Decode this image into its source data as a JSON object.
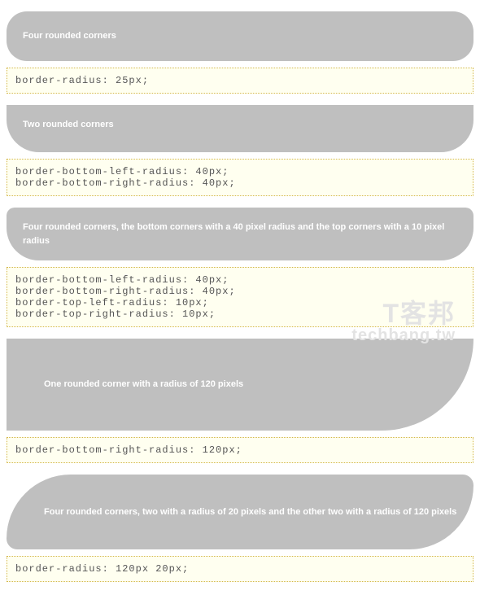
{
  "watermark": {
    "line1": "T客邦",
    "line2": "techbang.tw"
  },
  "examples": [
    {
      "label": "Four rounded corners",
      "code": "border-radius: 25px;"
    },
    {
      "label": "Two rounded corners",
      "code": "border-bottom-left-radius: 40px;\nborder-bottom-right-radius: 40px;"
    },
    {
      "label": "Four rounded corners, the bottom corners with a 40 pixel radius and the top corners with a 10 pixel radius",
      "code": "border-bottom-left-radius: 40px;\nborder-bottom-right-radius: 40px;\nborder-top-left-radius: 10px;\nborder-top-right-radius: 10px;"
    },
    {
      "label": "One rounded corner with a radius of 120 pixels",
      "code": "border-bottom-right-radius: 120px;"
    },
    {
      "label": "Four rounded corners, two with a radius of 20 pixels and the other two with a radius of 120 pixels",
      "code": "border-radius: 120px 20px;"
    }
  ]
}
